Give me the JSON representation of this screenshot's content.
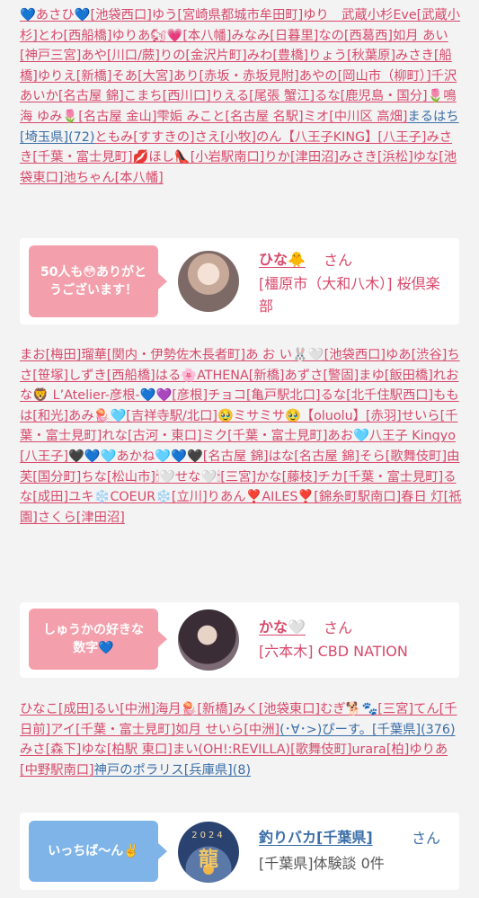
{
  "section1": {
    "links": [
      {
        "t": "💙あさひ💙[池袋西口]",
        "c": "p"
      },
      {
        "t": "ゆう[宮崎県都城市牟田町]",
        "c": "p"
      },
      {
        "t": "ゆり　武蔵小杉Eve[武蔵小杉]",
        "c": "p"
      },
      {
        "t": "とわ[西船橋]",
        "c": "p"
      },
      {
        "t": "ゆりあ🐿💗[本八幡]",
        "c": "p"
      },
      {
        "t": "みなみ[日暮里]",
        "c": "p"
      },
      {
        "t": "なの[西葛西]",
        "c": "p"
      },
      {
        "t": "如月 あい[神戸三宮]",
        "c": "p"
      },
      {
        "t": "あや[川口/蕨]",
        "c": "p"
      },
      {
        "t": "りの[金沢片町]",
        "c": "p"
      },
      {
        "t": "みわ[豊橋]",
        "c": "p"
      },
      {
        "t": "りょう[秋葉原]",
        "c": "p"
      },
      {
        "t": "みさき[船橋]",
        "c": "p"
      },
      {
        "t": "ゆりえ[新橋]",
        "c": "p"
      },
      {
        "t": "そあ[大宮]",
        "c": "p"
      },
      {
        "t": "あり[赤坂・赤坂見附]",
        "c": "p"
      },
      {
        "t": "あやの[岡山市（柳町）]",
        "c": "p"
      },
      {
        "t": "千沢 あいか[名古屋 錦]",
        "c": "p"
      },
      {
        "t": "こまち[西川口]",
        "c": "p"
      },
      {
        "t": "りえる[尾張 蟹江]",
        "c": "p"
      },
      {
        "t": "るな[鹿児島・国分]",
        "c": "p"
      },
      {
        "t": "🌷鳴海 ゆみ🌷[名古屋 金山]",
        "c": "p"
      },
      {
        "t": "雫姤 みこと[名古屋 名駅]",
        "c": "p"
      },
      {
        "t": "ミオ[中川区 高畑]",
        "c": "p"
      },
      {
        "t": "まるはち[埼玉県](72)",
        "c": "b"
      },
      {
        "t": "ともみ[すすきの]",
        "c": "p"
      },
      {
        "t": "さえ[小牧]",
        "c": "p"
      },
      {
        "t": "のん【八王子KING】[八王子]",
        "c": "p"
      },
      {
        "t": "みさき[千葉・富士見町]",
        "c": "p"
      },
      {
        "t": "💋ほし👠[小岩駅南口]",
        "c": "p"
      },
      {
        "t": "りか[津田沼]",
        "c": "p"
      },
      {
        "t": "みさき[浜松]",
        "c": "p"
      },
      {
        "t": "ゆな[池袋東口]",
        "c": "p"
      },
      {
        "t": "池ちゃん[本八幡]",
        "c": "p"
      }
    ]
  },
  "card1": {
    "bubble": "50人も😳ありがとうございます！",
    "name": "ひな🐥",
    "honorific": "さん",
    "info": "[橿原市（大和八木）] 桜倶楽部"
  },
  "section2": {
    "links": [
      {
        "t": "まお[梅田]",
        "c": "p"
      },
      {
        "t": "瑠華[関内・伊勢佐木長者町]",
        "c": "p"
      },
      {
        "t": "あ お い🐰🤍[池袋西口]",
        "c": "p"
      },
      {
        "t": "ゆあ[渋谷]",
        "c": "p"
      },
      {
        "t": "ちさ[笹塚]",
        "c": "p"
      },
      {
        "t": "しずき[西船橋]",
        "c": "p"
      },
      {
        "t": "はる🌸ATHENA[新橋]",
        "c": "p"
      },
      {
        "t": "あずさ[警固]",
        "c": "p"
      },
      {
        "t": "まゆ[飯田橋]",
        "c": "p"
      },
      {
        "t": "れおな🦁 L’Atelier-彦根-💙💜[彦根]",
        "c": "p"
      },
      {
        "t": "チョコ[亀戸駅北口]",
        "c": "p"
      },
      {
        "t": "るな[北千住駅西口]",
        "c": "p"
      },
      {
        "t": "ももは[和光]",
        "c": "p"
      },
      {
        "t": "あみ🪼🩵[吉祥寺駅/北口]",
        "c": "p"
      },
      {
        "t": "🥹ミサミサ🥹【oluolu】[赤羽]",
        "c": "p"
      },
      {
        "t": "せいら[千葉・富士見町]",
        "c": "p"
      },
      {
        "t": "れな[古河・東口]",
        "c": "p"
      },
      {
        "t": "ミク[千葉・富士見町]",
        "c": "p"
      },
      {
        "t": "あお🩵八王子 Kingyo [八王子]",
        "c": "p"
      },
      {
        "t": "🖤💙🩵あかね🩵💙🖤[名古屋 錦]",
        "c": "p"
      },
      {
        "t": "はな[名古屋 錦]",
        "c": "p"
      },
      {
        "t": "そら[歌舞伎町]",
        "c": "p"
      },
      {
        "t": "由芙[国分町]",
        "c": "p"
      },
      {
        "t": "ちな[松山市]",
        "c": "p"
      },
      {
        "t": "🕯🤍せな🤍🕯[三宮]",
        "c": "p"
      },
      {
        "t": "かな[藤枝]",
        "c": "p"
      },
      {
        "t": "チカ[千葉・富士見町]",
        "c": "p"
      },
      {
        "t": "るな[成田]",
        "c": "p"
      },
      {
        "t": "ユキ❄️COEUR❄️[立川]",
        "c": "p"
      },
      {
        "t": "りあん❣️AILES❣️[錦糸町駅南口]",
        "c": "p"
      },
      {
        "t": "春日 灯[祇園]",
        "c": "p"
      },
      {
        "t": "さくら[津田沼]",
        "c": "p"
      }
    ]
  },
  "card2": {
    "bubble": "しゅうかの好きな数字💙",
    "name": "かな🤍",
    "honorific": "さん",
    "info": "[六本木] CBD NATION"
  },
  "section3": {
    "links": [
      {
        "t": "ひなこ[成田]",
        "c": "p"
      },
      {
        "t": "るい[中洲]",
        "c": "p"
      },
      {
        "t": "海月🪼[新橋]",
        "c": "p"
      },
      {
        "t": "みく[池袋東口]",
        "c": "p"
      },
      {
        "t": "むぎ🐕🐾[三宮]",
        "c": "p"
      },
      {
        "t": "てん[千日前]",
        "c": "p"
      },
      {
        "t": "アイ[千葉・富士見町]",
        "c": "p"
      },
      {
        "t": "如月 せいら[中洲]",
        "c": "p"
      },
      {
        "t": "(･∀･>)ぴーす。[千葉県](376)",
        "c": "b"
      },
      {
        "t": "みさ[森下]",
        "c": "p"
      },
      {
        "t": "ゆな[柏駅 東口]",
        "c": "p"
      },
      {
        "t": "まい(OH!:REVILLA)[歌舞伎町]",
        "c": "p"
      },
      {
        "t": "urara[柏]",
        "c": "p"
      },
      {
        "t": "ゆりあ[中野駅南口]",
        "c": "p"
      },
      {
        "t": "神戸のポラリス[兵庫県](8)",
        "c": "b"
      }
    ]
  },
  "card3": {
    "bubble": "いっちば〜ん✌️",
    "name": "釣りバカ[千葉県]",
    "honorific": "さん",
    "info": "[千葉県]体験談 0件",
    "avatar_year": "2024",
    "avatar_kanji": "龍"
  }
}
